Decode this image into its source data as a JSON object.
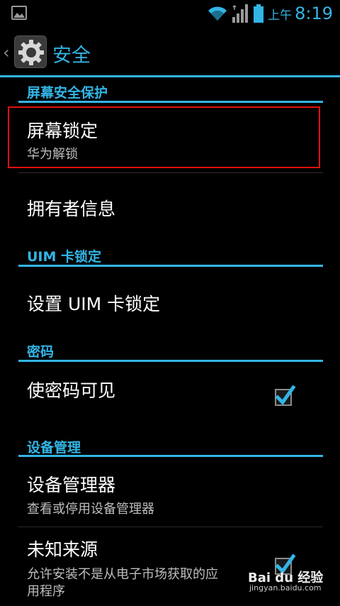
{
  "status_bar": {
    "ampm": "上午",
    "time": "8:19",
    "accent": "#33b5e5"
  },
  "action_bar": {
    "title": "安全"
  },
  "sections": {
    "screen": {
      "header": "屏幕安全保护",
      "items": [
        {
          "title": "屏幕锁定",
          "subtitle": "华为解锁"
        },
        {
          "title": "拥有者信息"
        }
      ]
    },
    "uim": {
      "header": "UIM 卡锁定",
      "items": [
        {
          "title": "设置 UIM 卡锁定"
        }
      ]
    },
    "password": {
      "header": "密码",
      "items": [
        {
          "title": "使密码可见",
          "checked": true
        }
      ]
    },
    "device": {
      "header": "设备管理",
      "items": [
        {
          "title": "设备管理器",
          "subtitle": "查看或停用设备管理器"
        },
        {
          "title": "未知来源",
          "subtitle_line1": "允许安装不是从电子市场获取的应",
          "subtitle_line2": "用程序",
          "checked": true
        }
      ]
    }
  },
  "watermark": {
    "logo": "Bai du 经验",
    "url": "jingyan.baidu.com"
  },
  "icons": {
    "status": [
      "gallery-icon",
      "wifi-icon",
      "signal-icon",
      "battery-icon"
    ],
    "action": [
      "back-chevron-icon",
      "settings-gear-icon"
    ]
  }
}
